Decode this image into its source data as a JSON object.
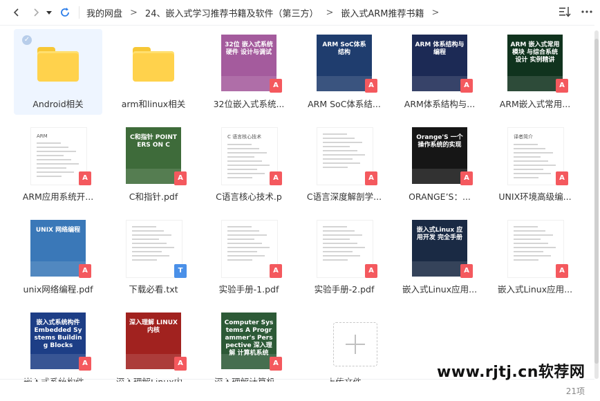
{
  "breadcrumb": [
    "我的网盘",
    "24、嵌入式学习推荐书籍及软件（第三方）",
    "嵌入式ARM推荐书籍"
  ],
  "breadcrumb_separator": ">",
  "files": [
    {
      "name": "Android相关",
      "type": "folder",
      "selected": true
    },
    {
      "name": "arm和linux相关",
      "type": "folder"
    },
    {
      "name": "32位嵌入式系统...",
      "type": "pdf",
      "cover_text": "32位 嵌入式系统硬件 设计与调试",
      "cover_color": "#a45b9d"
    },
    {
      "name": "ARM SoC体系结...",
      "type": "pdf",
      "cover_text": "ARM SoC体系结构",
      "cover_color": "#1f3d6e"
    },
    {
      "name": "ARM体系结构与...",
      "type": "pdf",
      "cover_text": "ARM 体系结构与编程",
      "cover_color": "#1c2a55"
    },
    {
      "name": "ARM嵌入式常用...",
      "type": "pdf",
      "cover_text": "ARM 嵌入式常用模块 与综合系统设计 实例精讲",
      "cover_color": "#10331e"
    },
    {
      "name": "ARM应用系统开...",
      "type": "pdf",
      "cover_text": "ARM",
      "cover_color": "#ffffff"
    },
    {
      "name": "C和指针.pdf",
      "type": "pdf",
      "cover_text": "C和指针 POINTERS ON C",
      "cover_color": "#3e6b3a"
    },
    {
      "name": "C语言核心技术.p",
      "type": "pdf",
      "cover_text": "C 语言核心技术",
      "cover_color": "#ffffff"
    },
    {
      "name": "C语言深度解剖学...",
      "type": "pdf",
      "cover_text": "",
      "cover_color": "#ffffff"
    },
    {
      "name": "ORANGE’S：...",
      "type": "pdf",
      "cover_text": "Orange'S 一个操作系统的实现",
      "cover_color": "#161616"
    },
    {
      "name": "UNIX环境高级编...",
      "type": "pdf",
      "cover_text": "译者简介",
      "cover_color": "#ffffff"
    },
    {
      "name": "unix网络编程.pdf",
      "type": "pdf",
      "cover_text": "UNIX 网络编程",
      "cover_color": "#3a78b8"
    },
    {
      "name": "下载必看.txt",
      "type": "txt",
      "cover_text": "",
      "cover_color": "#ffffff"
    },
    {
      "name": "实验手册-1.pdf",
      "type": "pdf",
      "cover_text": "",
      "cover_color": "#ffffff"
    },
    {
      "name": "实验手册-2.pdf",
      "type": "pdf",
      "cover_text": "",
      "cover_color": "#ffffff"
    },
    {
      "name": "嵌入式Linux应用...",
      "type": "pdf",
      "cover_text": "嵌入式Linux 应用开发 完全手册",
      "cover_color": "#1a2a44"
    },
    {
      "name": "嵌入式Linux应用...",
      "type": "pdf",
      "cover_text": "",
      "cover_color": "#ffffff"
    },
    {
      "name": "嵌入式系统构件...",
      "type": "pdf",
      "cover_text": "嵌入式系统构件 Embedded Systems Building Blocks",
      "cover_color": "#1d3e86"
    },
    {
      "name": "深入理解Linux内...",
      "type": "pdf",
      "cover_text": "深入理解 LINUX 内核",
      "cover_color": "#a1221f"
    },
    {
      "name": "深入理解计算机...",
      "type": "pdf",
      "cover_text": "Computer Systems A Programmer's Perspective 深入理解 计算机系统",
      "cover_color": "#2d5a37"
    },
    {
      "name": "上传文件",
      "type": "upload"
    }
  ],
  "item_count": "21项",
  "watermark": "www.rjtj.cn软荐网",
  "badges": {
    "pdf": "A",
    "txt": "T"
  },
  "icons": {
    "back": "chevron-left-icon",
    "forward": "chevron-right-icon",
    "dropdown": "caret-down-icon",
    "refresh": "refresh-icon",
    "sort": "sort-icon",
    "more": "more-icon"
  }
}
